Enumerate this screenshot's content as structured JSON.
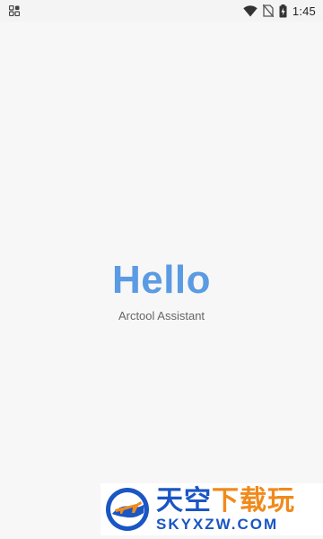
{
  "status_bar": {
    "time": "1:45",
    "icons": [
      "notification-app-icon",
      "wifi-icon",
      "no-sim-icon",
      "battery-charging-icon"
    ]
  },
  "main": {
    "title": "Hello",
    "subtitle": "Arctool Assistant"
  },
  "watermark": {
    "cn_part1": "天空",
    "cn_part2": "下载玩",
    "en": "SKYXZW.COM",
    "colors": {
      "blue": "#1a56c4",
      "orange": "#f08a1c"
    }
  },
  "colors": {
    "title": "#5b9be3",
    "background": "#f7f7f7"
  }
}
